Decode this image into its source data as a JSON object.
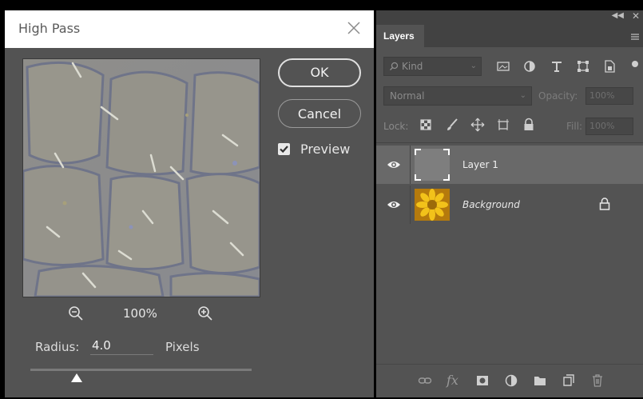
{
  "dialog": {
    "title": "High Pass",
    "ok_label": "OK",
    "cancel_label": "Cancel",
    "preview_label": "Preview",
    "preview_checked": true,
    "zoom_level": "100%",
    "radius_label": "Radius:",
    "radius_value": "4.0",
    "radius_unit": "Pixels",
    "slider_level": 0.21,
    "icons": [
      "close-icon",
      "zoom-out-icon",
      "zoom-in-icon",
      "checkmark-icon"
    ]
  },
  "layers_panel": {
    "tab_label": "Layers",
    "filter": {
      "label": "Kind",
      "icons": [
        "pixel-filter-icon",
        "adjustment-filter-icon",
        "type-filter-icon",
        "shape-filter-icon",
        "smart-object-filter-icon"
      ]
    },
    "blend_mode": "Normal",
    "opacity_label": "Opacity:",
    "opacity_value": "100%",
    "lock_label": "Lock:",
    "fill_label": "Fill:",
    "fill_value": "100%",
    "layers": [
      {
        "name": "Layer 1",
        "visible": true,
        "selected": true,
        "locked": false
      },
      {
        "name": "Background",
        "visible": true,
        "selected": false,
        "locked": true
      }
    ],
    "footer_icons": [
      "link-icon",
      "fx-icon",
      "mask-icon",
      "adjustment-icon",
      "folder-icon",
      "new-layer-icon",
      "trash-icon"
    ],
    "fx_label": "fx"
  },
  "colors": {
    "panel_bg": "#535353",
    "selected_layer": "#696969",
    "titlebar": "#ffffff"
  }
}
